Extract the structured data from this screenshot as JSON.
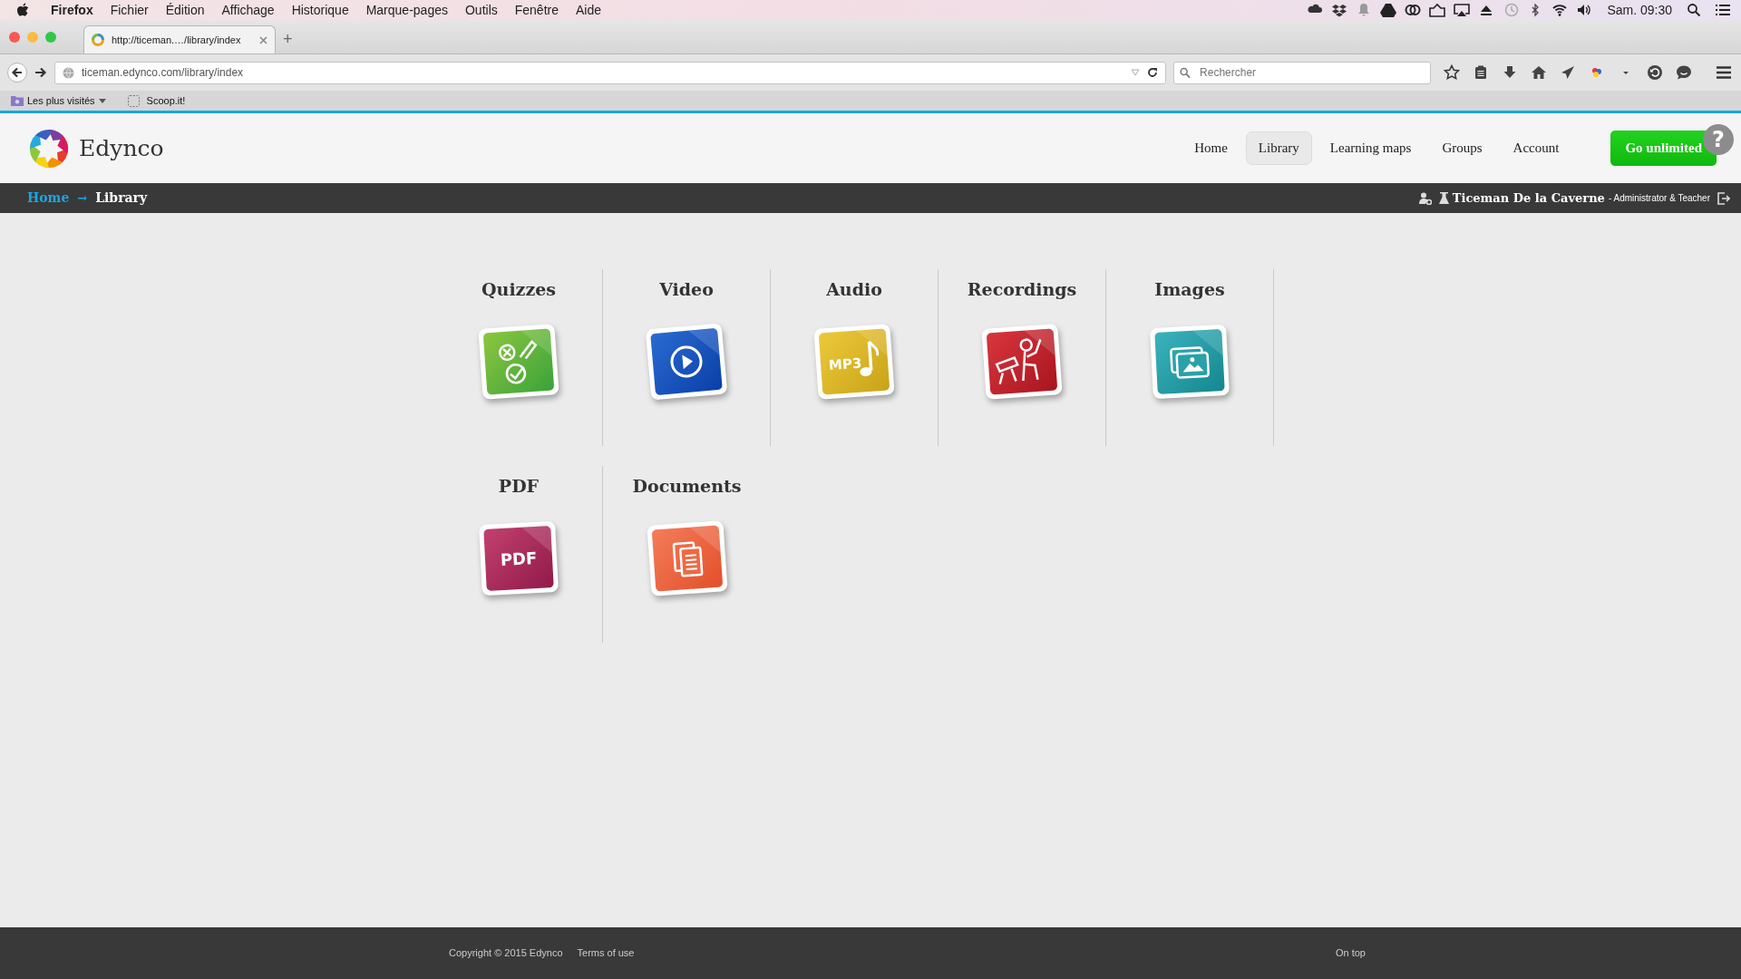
{
  "menubar": {
    "app": "Firefox",
    "items": [
      "Fichier",
      "Édition",
      "Affichage",
      "Historique",
      "Marque-pages",
      "Outils",
      "Fenêtre",
      "Aide"
    ],
    "clock": "Sam. 09:30"
  },
  "browser": {
    "tabs": [
      {
        "title": "http://ticeman.…/library/index",
        "selected": true
      }
    ],
    "new_tab": "+",
    "url": "ticeman.edynco.com/library/index",
    "search": {
      "placeholder": "Rechercher"
    },
    "bookmarks": [
      {
        "label": "Les plus visités",
        "kind": "folder"
      },
      {
        "label": "Scoop.it!",
        "kind": "page"
      }
    ]
  },
  "site": {
    "brand": "Edynco",
    "nav": [
      {
        "label": "Home",
        "selected": false
      },
      {
        "label": "Library",
        "selected": true
      },
      {
        "label": "Learning maps",
        "selected": false
      },
      {
        "label": "Groups",
        "selected": false
      },
      {
        "label": "Account",
        "selected": false
      }
    ],
    "cta": "Go unlimited",
    "help": "?"
  },
  "breadcrumb": {
    "items": [
      {
        "label": "Home",
        "kind": "link"
      },
      {
        "label": "Library",
        "kind": "current"
      }
    ],
    "separator": "→"
  },
  "user": {
    "name": "Ticeman De la Caverne",
    "role": "- Administrator & Teacher"
  },
  "library": [
    {
      "title": "Quizzes",
      "kind": "quiz"
    },
    {
      "title": "Video",
      "kind": "video"
    },
    {
      "title": "Audio",
      "kind": "audio",
      "icon_text": "MP3"
    },
    {
      "title": "Recordings",
      "kind": "recording"
    },
    {
      "title": "Images",
      "kind": "images"
    },
    {
      "title": "PDF",
      "kind": "pdf",
      "icon_text": "PDF"
    },
    {
      "title": "Documents",
      "kind": "documents"
    }
  ],
  "footer": {
    "copyright": "Copyright © 2015 Edynco",
    "links": [
      "Terms of use"
    ],
    "on_top": "On top"
  }
}
